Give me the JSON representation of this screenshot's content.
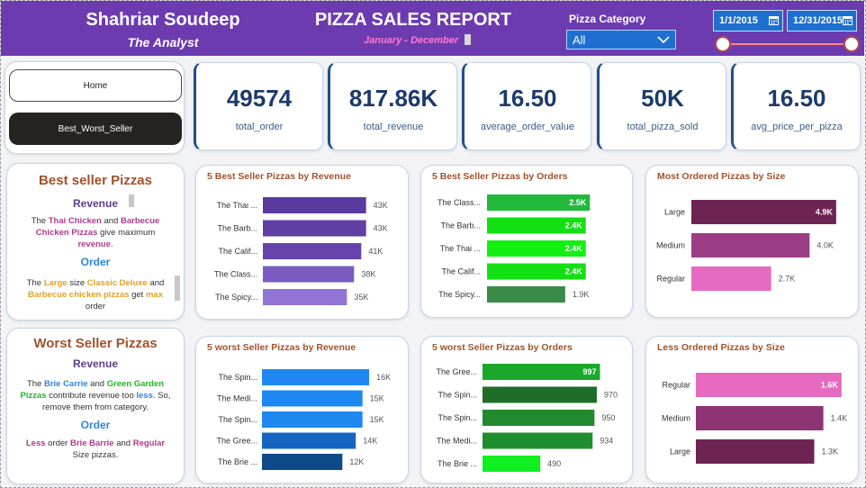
{
  "header": {
    "author": "Shahriar Soudeep",
    "role": "The Analyst",
    "title": "PIZZA SALES REPORT",
    "period": "January - December",
    "category_label": "Pizza Category",
    "category_value": "All",
    "date_start": "1/1/2015",
    "date_end": "12/31/2015"
  },
  "nav": {
    "home_label": "Home",
    "best_worst_label": "Best_Worst_Seller"
  },
  "kpis": [
    {
      "value": "49574",
      "label": "total_order"
    },
    {
      "value": "817.86K",
      "label": "total_revenue"
    },
    {
      "value": "16.50",
      "label": "average_order_value"
    },
    {
      "value": "50K",
      "label": "total_pizza_sold"
    },
    {
      "value": "16.50",
      "label": "avg_price_per_pizza"
    }
  ],
  "best_text": {
    "title": "Best seller Pizzas",
    "revenue_heading": "Revenue",
    "revenue_p1": "The ",
    "revenue_h1": "Thai Chicken",
    "revenue_p2": " and ",
    "revenue_h2": "Barbecue Chicken Pizzas",
    "revenue_p3": " give maximum ",
    "revenue_h3": "revenue",
    "revenue_p4": ".",
    "order_heading": "Order",
    "order_p1": "The ",
    "order_h1": "Large",
    "order_p2": " size ",
    "order_h2": "Classic Deluxe",
    "order_p3": " and ",
    "order_h3": "Barbecue chicken pizzas",
    "order_p4": " get ",
    "order_h4": "max",
    "order_p5": " order"
  },
  "worst_text": {
    "title": "Worst Seller Pizzas",
    "revenue_heading": "Revenue",
    "revenue_p1": "The ",
    "revenue_h1": "Brie Carrie",
    "revenue_p2": " and ",
    "revenue_h2": "Green Garden Pizzas",
    "revenue_p3": " contribute revenue too ",
    "revenue_h3": "less",
    "revenue_p4": ". So, remove them from category.",
    "order_heading": "Order",
    "order_h1": "Less",
    "order_p1": " order ",
    "order_h2": "Brie Barrie",
    "order_p2": " and ",
    "order_h3": "Regular",
    "order_p3": " Size pizzas."
  },
  "colors": {
    "header_bg": "#6c3bb0",
    "kpi_value": "#1b3a6b",
    "title_brown": "#a0522d",
    "purple_text": "#5a3e8c",
    "blue_text": "#2e86de",
    "magenta": "#b03a8c",
    "gold": "#e0a321",
    "green_text": "#22b522"
  },
  "chart_data": [
    {
      "type": "bar",
      "title": "5 Best Seller Pizzas by Revenue",
      "categories": [
        "The Thai ...",
        "The Barb...",
        "The Calif...",
        "The Class...",
        "The Spicy..."
      ],
      "values": [
        43,
        43,
        41,
        38,
        35
      ],
      "value_labels": [
        "43K",
        "43K",
        "41K",
        "38K",
        "35K"
      ],
      "colors": [
        "#5b3a9e",
        "#5f3fa3",
        "#6444ab",
        "#7a5cc0",
        "#9274d4"
      ],
      "xlim": [
        0,
        48
      ]
    },
    {
      "type": "bar",
      "title": "5 Best Seller Pizzas by Orders",
      "categories": [
        "The Class...",
        "The Barb...",
        "The Thai ...",
        "The Calif...",
        "The Spicy..."
      ],
      "values": [
        2.5,
        2.4,
        2.4,
        2.4,
        1.9
      ],
      "value_labels": [
        "2.5K",
        "2.4K",
        "2.4K",
        "2.4K",
        "1.9K"
      ],
      "colors": [
        "#22b83a",
        "#12e012",
        "#12f012",
        "#12e012",
        "#3a8a48"
      ],
      "xlim": [
        0,
        2.8
      ]
    },
    {
      "type": "bar",
      "title": "Most Ordered Pizzas by Size",
      "categories": [
        "Large",
        "Medium",
        "Regular"
      ],
      "values": [
        4.9,
        4.0,
        2.7
      ],
      "value_labels": [
        "4.9K",
        "4.0K",
        "2.7K"
      ],
      "colors": [
        "#6e2453",
        "#9c3d86",
        "#e56ac0"
      ],
      "xlim": [
        0,
        5.3
      ]
    },
    {
      "type": "bar",
      "title": "5 worst Seller Pizzas by Revenue",
      "categories": [
        "The Spin...",
        "The Medi...",
        "The Spin...",
        "The Gree...",
        "The Brie ..."
      ],
      "values": [
        16,
        15,
        15,
        14,
        12
      ],
      "value_labels": [
        "16K",
        "15K",
        "15K",
        "14K",
        "12K"
      ],
      "colors": [
        "#1e88f0",
        "#1e88f0",
        "#1e88f0",
        "#1565c0",
        "#0e4a8a"
      ],
      "xlim": [
        0,
        18
      ]
    },
    {
      "type": "bar",
      "title": "5 worst Seller Pizzas by Orders",
      "categories": [
        "The Gree...",
        "The Spin...",
        "The Spin...",
        "The Medi...",
        "The Brie ..."
      ],
      "values": [
        997,
        970,
        950,
        934,
        490
      ],
      "value_labels": [
        "997",
        "970",
        "950",
        "934",
        "490"
      ],
      "colors": [
        "#1aa82a",
        "#1e6e2a",
        "#218a2e",
        "#1f8e2e",
        "#10f020"
      ],
      "xlim": [
        0,
        1100
      ]
    },
    {
      "type": "bar",
      "title": "Less Ordered Pizzas by Size",
      "categories": [
        "Regular",
        "Medium",
        "Large"
      ],
      "values": [
        1.6,
        1.4,
        1.3
      ],
      "value_labels": [
        "1.6K",
        "1.4K",
        "1.3K"
      ],
      "colors": [
        "#e56ac0",
        "#8e3475",
        "#6e2453"
      ],
      "xlim": [
        0,
        1.72
      ]
    }
  ]
}
